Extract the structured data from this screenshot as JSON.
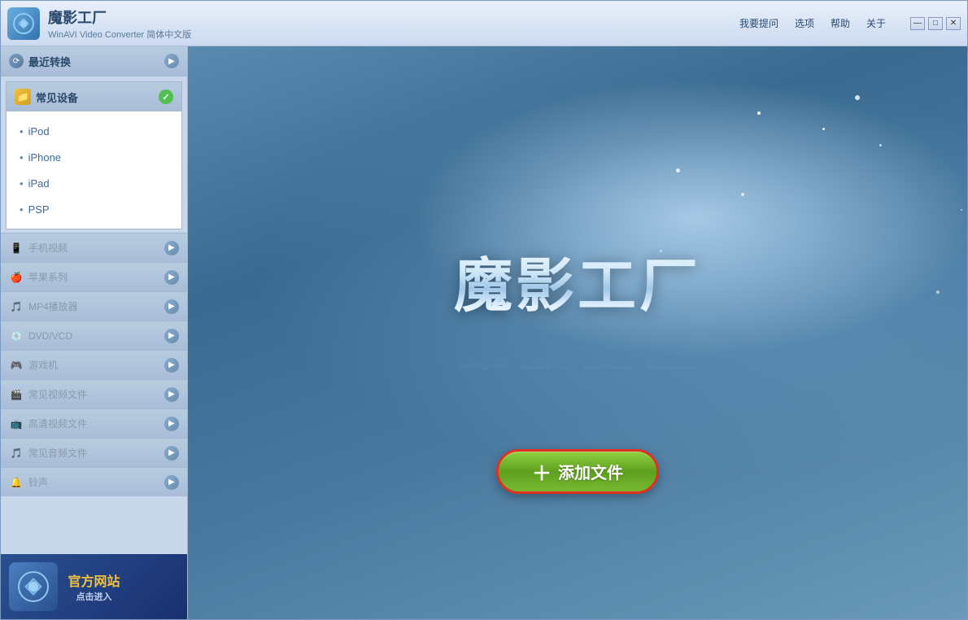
{
  "window": {
    "title": "魔影工厂",
    "subtitle": "WinAVI Video Converter 简体中文版",
    "controls": {
      "minimize": "—",
      "maximize": "□",
      "close": "✕"
    }
  },
  "menu": {
    "items": [
      "我要提问",
      "选项",
      "帮助",
      "关于"
    ]
  },
  "sidebar": {
    "recent": {
      "label": "最近转换",
      "icon": "⟳"
    },
    "common_devices": {
      "label": "常见设备",
      "items": [
        "iPod",
        "iPhone",
        "iPad",
        "PSP"
      ]
    },
    "categories": [
      {
        "label": "手机视频",
        "icon": "📱"
      },
      {
        "label": "苹果系列",
        "icon": "🍎"
      },
      {
        "label": "MP4播放器",
        "icon": "🎵"
      },
      {
        "label": "DVD/VCD",
        "icon": "💿"
      },
      {
        "label": "游戏机",
        "icon": "🎮"
      },
      {
        "label": "常见视频文件",
        "icon": "🎬"
      },
      {
        "label": "高清视频文件",
        "icon": "📺"
      },
      {
        "label": "常见音频文件",
        "icon": "🎵"
      },
      {
        "label": "铃声",
        "icon": "🔔"
      }
    ],
    "official_banner": {
      "title": "官方网站",
      "subtitle": "点击进入"
    }
  },
  "main": {
    "app_title": "魔影工厂",
    "add_file_button": "添加文件"
  }
}
